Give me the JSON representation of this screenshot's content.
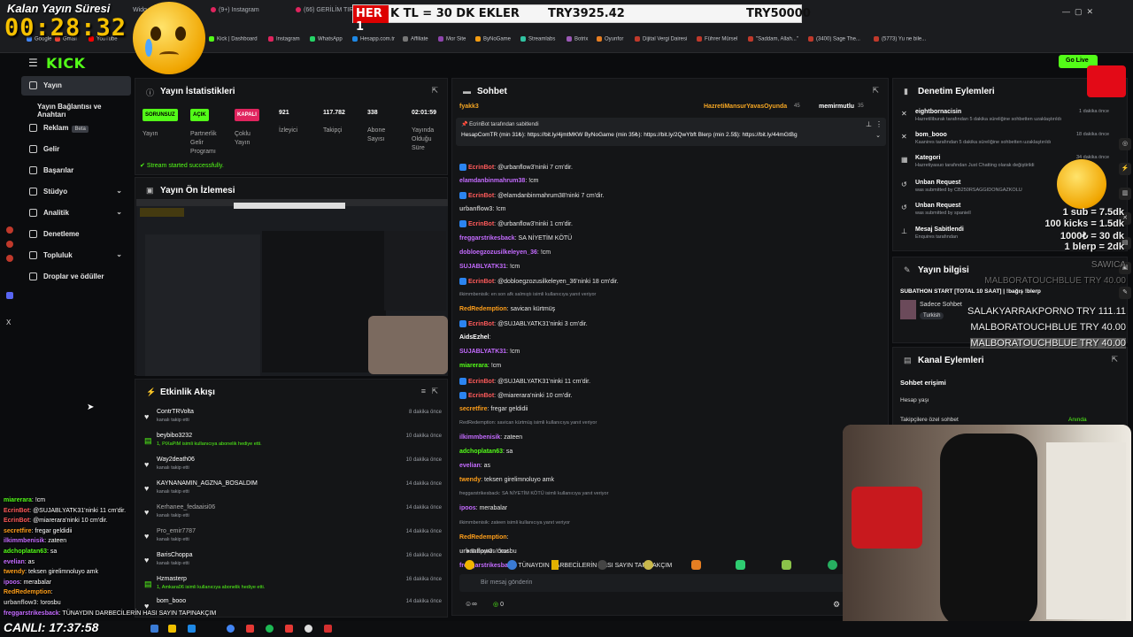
{
  "browser": {
    "tabs": [
      "Kalan Yayın Süresi",
      "Widg",
      "(9+) Instagram",
      "(66) GERİLİM TIRN"
    ],
    "bookmarks": [
      "Google",
      "Gmail",
      "YouTube",
      "Kick | Dashboard",
      "Instagram",
      "WhatsApp",
      "Hesapp.com.tr",
      "Affiliate",
      "Mor Site",
      "ByNoGame",
      "Streamlabs",
      "Botrix",
      "Oyunfor",
      "Dijital Vergi Dairesi",
      "Führer Mürsel",
      "\"Saddam, Allah...\"",
      "(3400) Sage The...",
      "(5773) Yu ne bile..."
    ]
  },
  "overlay": {
    "timer_label": "Kalan Yayın Süresi",
    "timer": "00:28:32",
    "banner_left": "HER 1",
    "banner_mid": "K TL = 30 DK EKLER",
    "banner_amount": "TRY3925.42",
    "banner_goal": "TRY50000",
    "canli": "CANLI: 17:37:58",
    "sub_rates": [
      "1 sub = 7.5dk",
      "100 kicks = 1.5dk",
      "1000₺ = 30 dk",
      "1 blerp = 2dk"
    ],
    "top_list": [
      {
        "name": "SAWICA",
        "amount": ""
      },
      {
        "name": "MALBORATOUCHBLUE",
        "amount": "TRY 40.00"
      },
      {
        "name": "SALAKYARRAKPORNO",
        "amount": "TRY 111.11"
      },
      {
        "name": "MALBORATOUCHBLUE",
        "amount": "TRY 40.00"
      },
      {
        "name": "MALBORATOUCHBLUE",
        "amount": "TRY 40.00"
      }
    ],
    "chat": [
      {
        "user": "miarerara",
        "text": "!cm",
        "color": "#53fc18"
      },
      {
        "user": "EcrinBot",
        "text": "@SUJABLYATK31'ninki 11 cm'dir.",
        "color": "#ff5a5a"
      },
      {
        "user": "EcrinBot",
        "text": "@miarerara'ninki 10 cm'dir.",
        "color": "#ff5a5a"
      },
      {
        "user": "secretfire",
        "text": "fregar geldidii",
        "color": "#ff9f1a"
      },
      {
        "user": "ilkimmbenisik",
        "text": "zateen",
        "color": "#c46bff"
      },
      {
        "user": "adchoplatan63",
        "text": "sa",
        "color": "#53fc18"
      },
      {
        "user": "evelian",
        "text": "as",
        "color": "#c46bff"
      },
      {
        "user": "twendy",
        "text": "teksen girelimnoluyo amk",
        "color": "#ff9f1a"
      },
      {
        "user": "ipoos",
        "text": "merabalar",
        "color": "#c46bff"
      },
      {
        "user": "RedRedemption",
        "text": "",
        "color": "#ff9f1a"
      },
      {
        "user": "urbanflow3",
        "text": "!orosbu",
        "color": "#bbbbbb"
      },
      {
        "user": "freggarstrikesback",
        "text": "TÜNAYDIN DARBECİLERİN HASI SAYIN TAPINAKÇIM",
        "color": "#c46bff"
      }
    ]
  },
  "kick": {
    "sidebar": [
      {
        "label": "Yayın",
        "active": true
      },
      {
        "label": "Yayın Bağlantısı ve Anahtarı"
      },
      {
        "label": "Reklam",
        "badge": "Beta"
      },
      {
        "label": "Gelir"
      },
      {
        "label": "Başarılar"
      },
      {
        "label": "Stüdyo",
        "expand": true
      },
      {
        "label": "Analitik",
        "expand": true
      },
      {
        "label": "Denetleme"
      },
      {
        "label": "Topluluk",
        "expand": true
      },
      {
        "label": "Droplar ve ödüller"
      }
    ],
    "go_live": "Go Live",
    "stats": {
      "title": "Yayın İstatistikleri",
      "items": [
        {
          "value": "SORUNSUZ",
          "label": "Yayın",
          "pill": "#53fc18"
        },
        {
          "value": "AÇIK",
          "label": "Partnerlik Gelir Programı",
          "pill": "#53fc18"
        },
        {
          "value": "KAPALI",
          "label": "Çoklu Yayın",
          "pill": "#e0245e"
        },
        {
          "value": "921",
          "label": "İzleyici"
        },
        {
          "value": "117.782",
          "label": "Takipçi"
        },
        {
          "value": "338",
          "label": "Abone Sayısı"
        },
        {
          "value": "02:01:59",
          "label": "Yayında Olduğu Süre"
        }
      ],
      "success": "Stream started successfully."
    },
    "preview": {
      "title": "Yayın Ön İzlemesi"
    },
    "activity": {
      "title": "Etkinlik Akışı",
      "items": [
        {
          "name": "ContrTRVolta",
          "sub": "kanalı takip etti",
          "time": "8 dakika önce"
        },
        {
          "name": "beybibo3232",
          "sub": "1, PiXaPiM isimli kullanıcıya abonelik hediye etti.",
          "time": "10 dakika önce"
        },
        {
          "name": "Way2death06",
          "sub": "kanalı takip etti",
          "time": "10 dakika önce"
        },
        {
          "name": "KAYNANAMIN_AGZNA_BOSALDIM",
          "sub": "kanalı takip etti",
          "time": "14 dakika önce"
        },
        {
          "name": "Kerhanee_fedaaisi06",
          "sub": "kanalı takip etti",
          "time": "14 dakika önce"
        },
        {
          "name": "Pro_emir7787",
          "sub": "kanalı takip etti",
          "time": "14 dakika önce"
        },
        {
          "name": "BarisChoppa",
          "sub": "kanalı takip etti",
          "time": "16 dakika önce"
        },
        {
          "name": "Hzmasterp",
          "sub": "1, Amkara06 isimli kullanıcıya abonelik hediye etti.",
          "time": "16 dakika önce"
        },
        {
          "name": "bom_booo",
          "sub": "",
          "time": "14 dakika önce"
        }
      ]
    },
    "chat": {
      "title": "Sohbet",
      "top_users": [
        "fyakk3",
        "HazretiMansurYavasOyunda",
        "memirmutlu"
      ],
      "top_counts": [
        "45",
        "35"
      ],
      "pinned_by": "EcrinBot tarafından sabitlendi",
      "pinned_text": "HesapComTR (min 31₺): https://bit.ly/4jmtMKW ByNoGame (min 35₺): https://bit.ly/2QwYbft Blerp (min 2.5$): https://bit.ly/44mGtBg",
      "messages": [
        {
          "user": "EcrinBot",
          "text": "@urbanflow3'ninki 7 cm'dir.",
          "color": "#ff5a5a",
          "badge": true
        },
        {
          "user": "elamdanbinmahrum38",
          "text": "!cm",
          "color": "#c46bff"
        },
        {
          "user": "EcrinBot",
          "text": "@elamdanbinmahrum38'ninki 7 cm'dir.",
          "color": "#ff5a5a",
          "badge": true
        },
        {
          "user": "urbanflow3",
          "text": "!cm",
          "color": "#bbbbbb"
        },
        {
          "user": "EcrinBot",
          "text": "@urbanflow3'ninki 1 cm'dir.",
          "color": "#ff5a5a",
          "badge": true
        },
        {
          "user": "freggarstrikesback",
          "text": "SA NİYETİM KÖTÜ",
          "color": "#c46bff"
        },
        {
          "user": "dobloegzozusilkeleyen_36",
          "text": "!cm",
          "color": "#c46bff"
        },
        {
          "user": "SUJABLYATK31",
          "text": "!cm",
          "color": "#c46bff"
        },
        {
          "user": "EcrinBot",
          "text": "@dobloegzozusilkeleyen_36'ninki 18 cm'dir.",
          "color": "#ff5a5a",
          "badge": true
        },
        {
          "small": "ilkimmbenisik: en son afk salmıştı isimli kullanıcıya yanıt veriyor"
        },
        {
          "user": "RedRedemption",
          "text": "savican kürtmüş",
          "color": "#ff9f1a"
        },
        {
          "user": "EcrinBot",
          "text": "@SUJABLYATK31'ninki 3 cm'dir.",
          "color": "#ff5a5a",
          "badge": true
        },
        {
          "user": "AidsEzhel",
          "text": "",
          "color": "#ffffff"
        },
        {
          "user": "SUJABLYATK31",
          "text": "!cm",
          "color": "#c46bff"
        },
        {
          "user": "miarerara",
          "text": "!cm",
          "color": "#53fc18"
        },
        {
          "user": "EcrinBot",
          "text": "@SUJABLYATK31'ninki 11 cm'dir.",
          "color": "#ff5a5a",
          "badge": true
        },
        {
          "user": "EcrinBot",
          "text": "@miarerara'ninki 10 cm'dir.",
          "color": "#ff5a5a",
          "badge": true
        },
        {
          "user": "secretfire",
          "text": "fregar geldidii",
          "color": "#ff9f1a"
        },
        {
          "small": "RedRedemption: savican kürtmüş isimli kullanıcıya yanıt veriyor"
        },
        {
          "user": "ilkimmbenisik",
          "text": "zateen",
          "color": "#c46bff"
        },
        {
          "user": "adchoplatan63",
          "text": "sa",
          "color": "#53fc18"
        },
        {
          "user": "evelian",
          "text": "as",
          "color": "#c46bff"
        },
        {
          "user": "twendy",
          "text": "teksen girelimnoluyo amk",
          "color": "#ff9f1a"
        },
        {
          "small": "freggarstrikesback: SA NİYETİM KÖTÜ isimli kullanıcıya yanıt veriyor"
        },
        {
          "user": "ipoos",
          "text": "merabalar",
          "color": "#c46bff"
        },
        {
          "small": "ilkimmbenisik: zateen isimli kullanıcıya yanıt veriyor"
        },
        {
          "user": "RedRedemption",
          "text": "",
          "color": "#ff9f1a"
        },
        {
          "user": "urbanflow3",
          "text": "!orosbu",
          "color": "#bbbbbb"
        },
        {
          "user": "freggarstrikesback",
          "text": "TÜNAYDIN DARBECİLERİN HASI SAYIN TAPINAKÇIM",
          "color": "#c46bff"
        }
      ],
      "followers_only": "Takipçilere Özel",
      "input_placeholder": "Bir mesaj gönderin",
      "points": "0"
    },
    "moderation": {
      "title": "Denetim Eylemleri",
      "items": [
        {
          "title": "eightbornacisin",
          "sub": "Hazretiliburak tarafından 5 dakika süreliğine sohbetten uzaklaştırıldı",
          "time": "1 dakika önce"
        },
        {
          "title": "bom_booo",
          "sub": "Kaanires tarafından 5 dakika süreliğine sohbetten uzaklaştırıldı",
          "time": "18 dakika önce"
        },
        {
          "title": "Kategori",
          "sub": "Hazretiyasuo tarafından Just Chatting olarak değiştirildi",
          "time": "34 dakika önce"
        },
        {
          "title": "Unban Request",
          "sub": "was submitted by CB250RSAGGIDONGAZKOLU",
          "time": ""
        },
        {
          "title": "Unban Request",
          "sub": "was submitted by spaniell",
          "time": ""
        },
        {
          "title": "Mesaj Sabitlendi",
          "sub": "Enquires tarafından",
          "time": ""
        }
      ]
    },
    "stream_info": {
      "title": "Yayın bilgisi",
      "stream_title": "SUBATHON START [TOTAL 10 SAAT] | !bağış !blerp",
      "category": "Sadece Sohbet",
      "tag": "Turkish"
    },
    "channel_actions": {
      "title": "Kanal Eylemleri",
      "chat_access": "Sohbet erişimi",
      "account_age": "Hesap yaşı",
      "followers_only": "Takipçilere özel sohbet",
      "followers_value": "Anında"
    }
  }
}
